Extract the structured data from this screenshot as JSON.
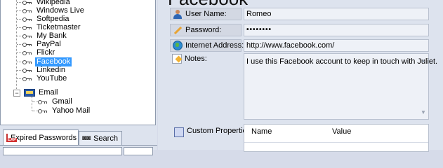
{
  "tree": {
    "items": [
      {
        "label": "Wikipedia",
        "selected": false
      },
      {
        "label": "Windows Live",
        "selected": false
      },
      {
        "label": "Softpedia",
        "selected": false
      },
      {
        "label": "Ticketmaster",
        "selected": false
      },
      {
        "label": "My Bank",
        "selected": false
      },
      {
        "label": "PayPal",
        "selected": false
      },
      {
        "label": "Flickr",
        "selected": false
      },
      {
        "label": "Facebook",
        "selected": true
      },
      {
        "label": "Linkedin",
        "selected": false
      },
      {
        "label": "YouTube",
        "selected": false
      }
    ],
    "group": {
      "label": "Email",
      "expander": "−",
      "children": [
        {
          "label": "Gmail"
        },
        {
          "label": "Yahoo Mail"
        }
      ]
    }
  },
  "tabs": [
    {
      "label": "Expired Passwords",
      "icon": "expired-passwords-icon",
      "active": true
    },
    {
      "label": "Search",
      "icon": "binoculars-icon",
      "active": false
    }
  ],
  "detail": {
    "title": "Facebook",
    "fields": {
      "username": {
        "label": "User Name:",
        "value": "Romeo"
      },
      "password": {
        "label": "Password:",
        "value": "••••••••"
      },
      "internet_address": {
        "label": "Internet Address:",
        "value": "http://www.facebook.com/"
      },
      "notes": {
        "label": "Notes:",
        "value": "I use this Facebook account to keep in touch with Juliet."
      }
    },
    "custom_properties": {
      "label": "Custom Properties:",
      "columns": [
        "Name",
        "Value"
      ]
    }
  },
  "colors": {
    "selection": "#3399ff",
    "panel_background": "#dde3ee",
    "field_background": "#eef1f7"
  }
}
